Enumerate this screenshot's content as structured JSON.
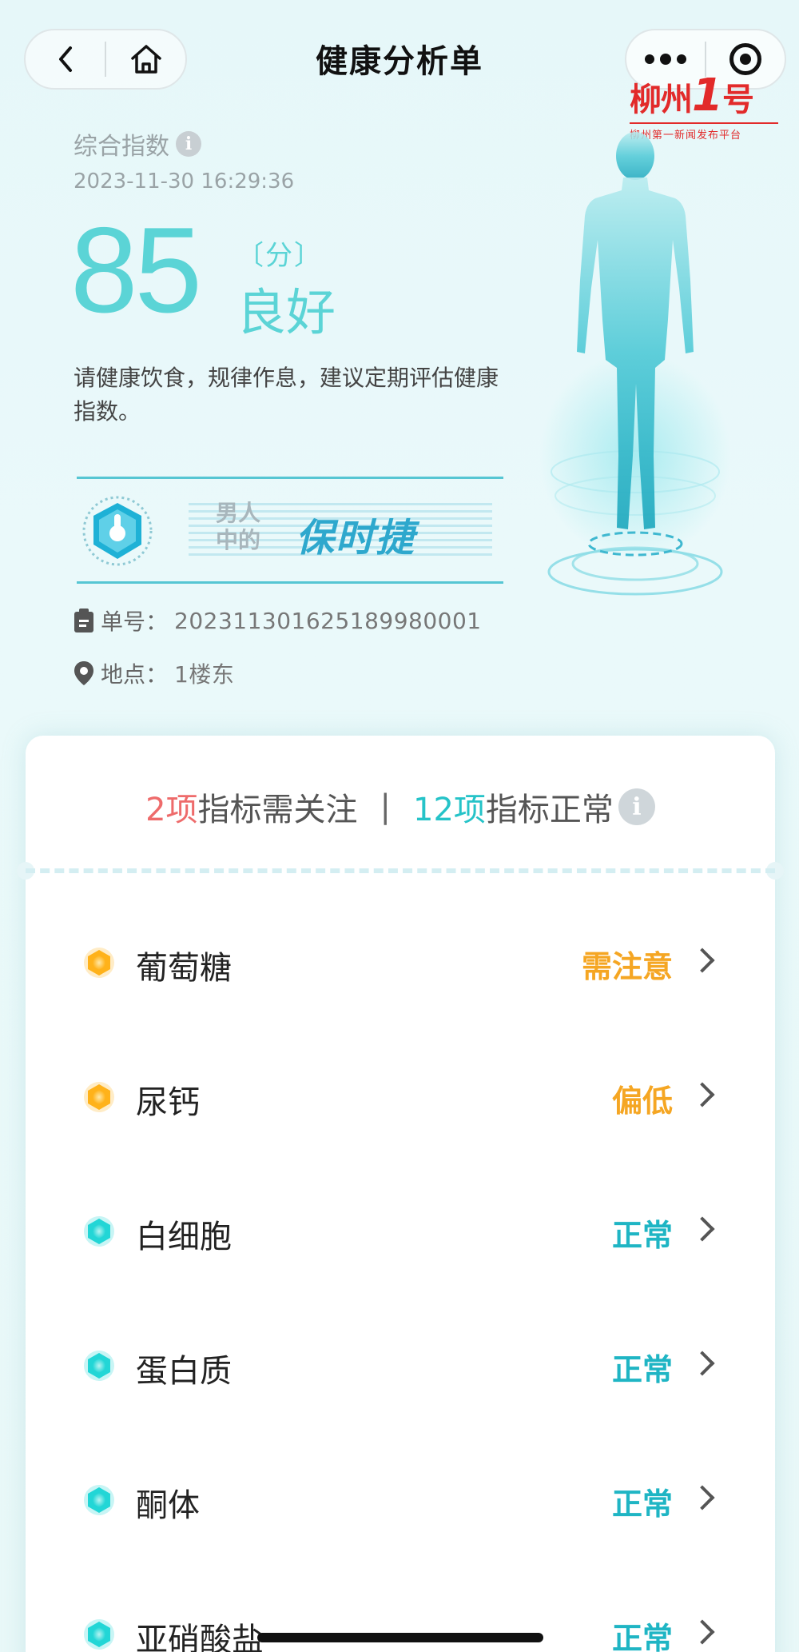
{
  "nav": {
    "title": "健康分析单",
    "back": "back-arrow-icon",
    "home": "home-icon",
    "more": "more-dots-icon",
    "close": "mini-program-target-icon"
  },
  "watermark": {
    "brand": "柳州",
    "brand_num": "1",
    "brand_suffix": "号",
    "slogan": "柳州第一新闻发布平台"
  },
  "summary": {
    "label": "综合指数",
    "datetime": "2023-11-30 16:29:36",
    "score": "85",
    "unit": "〔分〕",
    "level": "良好",
    "advice": "请健康饮食，规律作息，建议定期评估健康指数。"
  },
  "banner": {
    "line1": "男人",
    "line2": "中的",
    "highlight": "保时捷"
  },
  "meta": {
    "order_label": "单号：",
    "order_value": "202311301625189980001",
    "place_label": "地点：",
    "place_value": "1楼东"
  },
  "card": {
    "attention_count": "2项",
    "attention_text": "指标需关注",
    "divider": "|",
    "normal_count": "12项",
    "normal_text": "指标正常",
    "rows": [
      {
        "name": "葡萄糖",
        "status": "需注意",
        "kind": "warn"
      },
      {
        "name": "尿钙",
        "status": "偏低",
        "kind": "warn"
      },
      {
        "name": "白细胞",
        "status": "正常",
        "kind": "ok"
      },
      {
        "name": "蛋白质",
        "status": "正常",
        "kind": "ok"
      },
      {
        "name": "酮体",
        "status": "正常",
        "kind": "ok"
      },
      {
        "name": "亚硝酸盐",
        "status": "正常",
        "kind": "ok"
      }
    ]
  },
  "colors": {
    "accent": "#5bd4d6",
    "warn": "#f5a623",
    "ok": "#1fb5c4",
    "attention": "#ee6b6b"
  }
}
